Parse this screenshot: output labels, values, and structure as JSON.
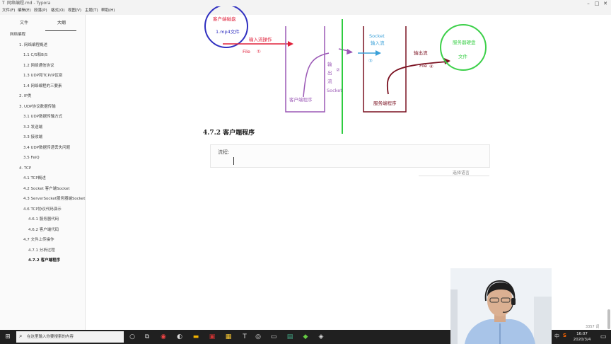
{
  "window": {
    "title": "网络编程.md - Typora",
    "controls": {
      "minimize": "–",
      "maximize": "□",
      "close": "✕"
    }
  },
  "menu": [
    "文件(F)",
    "编辑(E)",
    "段落(P)",
    "格式(O)",
    "视图(V)",
    "主题(T)",
    "帮助(H)"
  ],
  "sidebar": {
    "tabs": [
      "文件",
      "大纲"
    ],
    "active_tab": 1,
    "outline": [
      {
        "label": "网络编程",
        "level": 0
      },
      {
        "label": "1. 网络编程概述",
        "level": 1
      },
      {
        "label": "1.1 C/S和B/S",
        "level": 2
      },
      {
        "label": "1.2 网络通信协议",
        "level": 2
      },
      {
        "label": "1.3 UDP和TCP/IP区别",
        "level": 2
      },
      {
        "label": "1.4 网络编程的三要素",
        "level": 2
      },
      {
        "label": "2. IP类",
        "level": 1
      },
      {
        "label": "3. UDP协议数据传输",
        "level": 1
      },
      {
        "label": "3.1 UDP数据传输方式",
        "level": 2
      },
      {
        "label": "3.2 发送端",
        "level": 2
      },
      {
        "label": "3.3 接收端",
        "level": 2
      },
      {
        "label": "3.4 UDP数据传递丢失问题",
        "level": 2
      },
      {
        "label": "3.5 FeiQ",
        "level": 2
      },
      {
        "label": "4. TCP",
        "level": 1
      },
      {
        "label": "4.1 TCP概述",
        "level": 2
      },
      {
        "label": "4.2 Socket 客户端Socket",
        "level": 2
      },
      {
        "label": "4.3 ServerSocket服务器端Socket",
        "level": 2
      },
      {
        "label": "4.6 TCP协议代码演示",
        "level": 2
      },
      {
        "label": "4.6.1 服务器代码",
        "level": 3
      },
      {
        "label": "4.6.2 客户端代码",
        "level": 3
      },
      {
        "label": "4.7 文件上传操作",
        "level": 2
      },
      {
        "label": "4.7.1 分析过程",
        "level": 3
      },
      {
        "label": "4.7.2 客户端程序",
        "level": 3,
        "active": true
      }
    ],
    "footer": {
      "back": "<",
      "source": "</>"
    }
  },
  "diagram": {
    "client_disk": "客户端磁盘",
    "file_name": "1.mp4文件",
    "input_stream": "输入流操作",
    "file_label_1": "File",
    "step_1": "①",
    "output_chars": [
      "输",
      "出",
      "流"
    ],
    "step_2": "②",
    "socket_vertical": "Socket",
    "client_program": "客户端程序",
    "socket_top": "Socket",
    "socket_input": "输入流",
    "step_3": "③",
    "output_stream": "输出流",
    "file_label_4": "File",
    "step_4": "④",
    "server_program": "服务端程序",
    "server_disk": "服务器硬盘",
    "server_file": "文件",
    "colors": {
      "purple": "#9b59b6",
      "green": "#2ecc40",
      "maroon": "#7a1020",
      "red": "#e0203a",
      "cyan": "#3aa0d8",
      "circle_blue": "#3030c0",
      "circle_green": "#3dd04a"
    }
  },
  "editor": {
    "heading": "4.7.2 客户端程序",
    "code_text": "流程:",
    "language_placeholder": "选择语言",
    "word_count": "3357 词"
  },
  "taskbar": {
    "start_icon": "windows-icon",
    "search_placeholder": "在这里输入你要搜索的内容",
    "time": "16:07",
    "date": "2020/3/4",
    "ime": "中",
    "badge": "S"
  }
}
